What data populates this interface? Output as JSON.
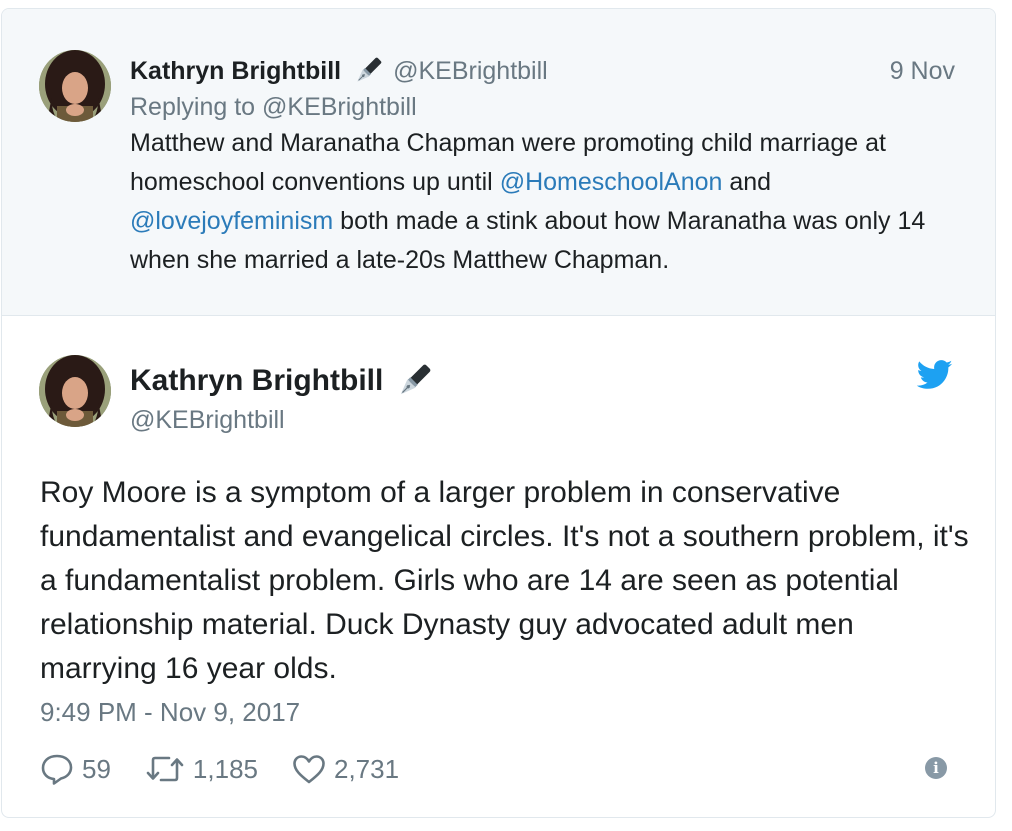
{
  "parent_tweet": {
    "author_name": "Kathryn Brightbill",
    "author_handle": "@KEBrightbill",
    "date": "9 Nov",
    "replying_to": "Replying to @KEBrightbill",
    "text_part1": "Matthew and Maranatha Chapman were promoting child marriage at homeschool conventions up until ",
    "mention1": "@HomeschoolAnon",
    "text_part2": " and ",
    "mention2": "@lovejoyfeminism",
    "text_part3": " both made a stink about how Maranatha was only 14 when she married a late-20s Matthew Chapman."
  },
  "main_tweet": {
    "author_name": "Kathryn Brightbill",
    "author_handle": "@KEBrightbill",
    "text": "Roy Moore is a symptom of a larger problem in conservative fundamentalist and evangelical circles. It's not a southern problem, it's a fundamentalist problem. Girls who are 14 are seen as potential relationship material. Duck Dynasty guy advocated adult men marrying 16 year olds.",
    "timestamp": "9:49 PM - Nov 9, 2017",
    "replies": "59",
    "retweets": "1,185",
    "likes": "2,731"
  },
  "colors": {
    "link": "#2b7bb9",
    "twitter_blue": "#1da1f2",
    "muted": "#697882",
    "parent_bg": "#f5f8fa"
  },
  "icons": {
    "name_emoji": "fountain-pen-icon",
    "brand": "twitter-bird-icon",
    "reply": "reply-icon",
    "retweet": "retweet-icon",
    "like": "heart-icon",
    "info": "info-icon"
  }
}
